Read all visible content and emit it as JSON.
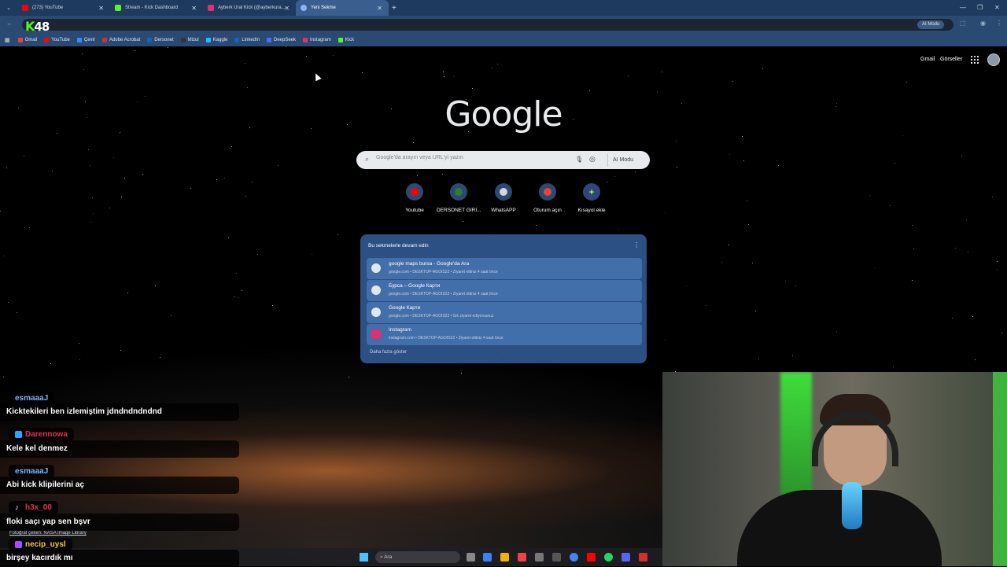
{
  "tabs": [
    {
      "title": "(273) YouTube",
      "color": "#ff0000"
    },
    {
      "title": "Stream - Kick Dashboard",
      "color": "#53fc18"
    },
    {
      "title": "Ayberk Ural Kick (@ayberkura...",
      "color": "#e1306c"
    },
    {
      "title": "Yeni Sekme",
      "color": "#8ab4f8",
      "active": true
    }
  ],
  "overlay_logo": {
    "letter": "K",
    "number": "48"
  },
  "omnibox": {
    "ai_mode": "AI Modu"
  },
  "bookmarks": [
    {
      "label": "Gmail",
      "color": "#ea4335"
    },
    {
      "label": "YouTube",
      "color": "#ff0000"
    },
    {
      "label": "Çevir",
      "color": "#4285f4"
    },
    {
      "label": "Adobe Acrobat",
      "color": "#d32f2f"
    },
    {
      "label": "Dersonet",
      "color": "#1565c0"
    },
    {
      "label": "Mizul",
      "color": "#333333"
    },
    {
      "label": "Kaggle",
      "color": "#20beff"
    },
    {
      "label": "LinkedIn",
      "color": "#0a66c2"
    },
    {
      "label": "DeepSeek",
      "color": "#4d6bfe"
    },
    {
      "label": "Instagram",
      "color": "#e1306c"
    },
    {
      "label": "Kick",
      "color": "#53fc18"
    }
  ],
  "header": {
    "gmail": "Gmail",
    "images": "Görseller"
  },
  "google": {
    "logo": "Google"
  },
  "search": {
    "placeholder": "Google'da arayın veya URL'yi yazın",
    "ai_mode": "AI Modu"
  },
  "shortcuts": [
    {
      "label": "Youtube",
      "color": "#ff0000"
    },
    {
      "label": "DERSONET GİRİ...",
      "color": "#2e7d32"
    },
    {
      "label": "WhatsAPP",
      "color": "#cfd8dc"
    },
    {
      "label": "Oturum açın",
      "color": "#ea4335"
    },
    {
      "label": "Kısayol ekle",
      "color": ""
    }
  ],
  "resume": {
    "title": "Bu sekmelerle devam edin",
    "items": [
      {
        "title": "google maps bursa - Google'da Ara",
        "sub": "google.com • DESKTOP-AGOIS22 • Ziyaret ettiniz 4 saat önce"
      },
      {
        "title": "Бурса – Google Карти",
        "sub": "google.com • DESKTOP-AGOIS22 • Ziyaret ettiniz 4 saat önce"
      },
      {
        "title": "Google Карти",
        "sub": "google.com • DESKTOP-AGOIS22 • Sık ziyaret ediyorsunuz"
      },
      {
        "title": "Instagram",
        "sub": "instagram.com • DESKTOP-AGOIS22 • Ziyaret ettiniz 4 saat önce"
      }
    ],
    "show_more": "Daha fazla göster"
  },
  "credit": "Fotoğraf çeken: NASA Image Library",
  "taskbar": {
    "search": "Ara"
  },
  "chat": [
    {
      "user": "esmaaaJ",
      "color": "#7fb0ff",
      "message": "Kicktekileri ben izlemiştim jdndndndndnd"
    },
    {
      "user": "Darennowa",
      "color": "#e0314c",
      "message": "Kele kel denmez"
    },
    {
      "user": "esmaaaJ",
      "color": "#7fb0ff",
      "message": "Abi kick klipilerini aç"
    },
    {
      "user": "h3x_00",
      "color": "#e0314c",
      "message": "floki saçı yap sen bşvr"
    },
    {
      "user": "necip_uysl",
      "color": "#f5c542",
      "message": "birşey kacırdık mı"
    }
  ]
}
